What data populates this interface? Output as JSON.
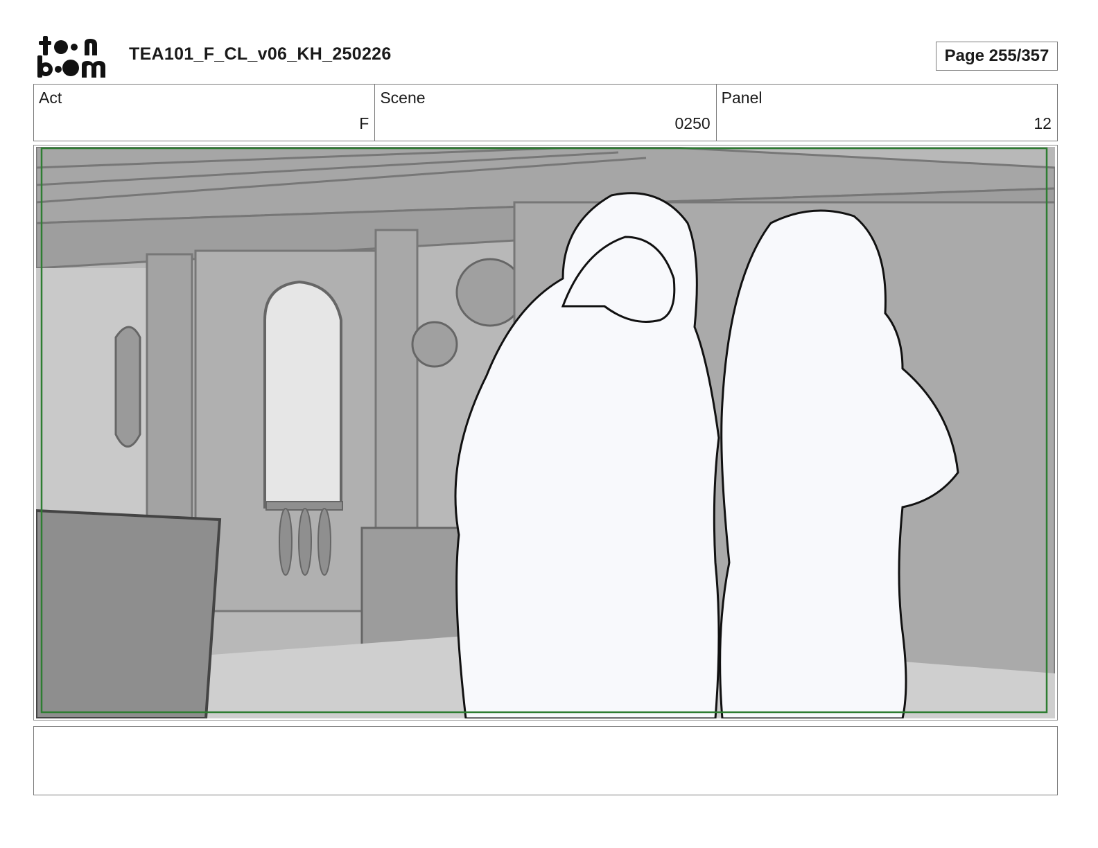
{
  "header": {
    "logo_text_top": "toon",
    "logo_text_bottom": "boom",
    "document_title": "TEA101_F_CL_v06_KH_250226",
    "page_indicator": "Page 255/357"
  },
  "info": {
    "act_label": "Act",
    "act_value": "F",
    "scene_label": "Scene",
    "scene_value": "0250",
    "panel_label": "Panel",
    "panel_value": "12"
  },
  "panel": {
    "description_icon": "storyboard-drawing",
    "safe_frame_color": "#2e7d32",
    "background_tone": "#b3b3b3",
    "character_fill": "#f8f9fc"
  },
  "notes": {
    "text": ""
  }
}
